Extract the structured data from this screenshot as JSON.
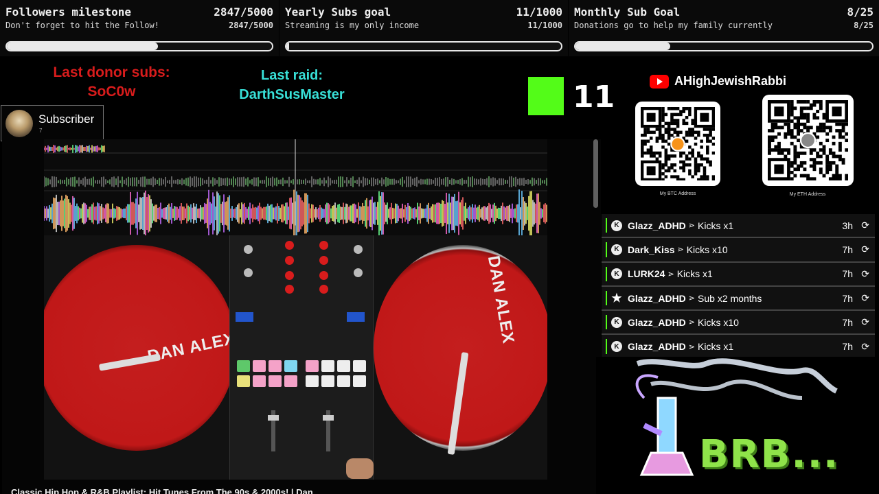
{
  "goals": [
    {
      "title": "Followers milestone",
      "count": "2847/5000",
      "subtitle": "Don't forget to hit the Follow!",
      "sub_count": "2847/5000",
      "progress": 0.5694
    },
    {
      "title": "Yearly Subs goal",
      "count": "11/1000",
      "subtitle": "Streaming is my only income",
      "sub_count": "11/1000",
      "progress": 0.011
    },
    {
      "title": "Monthly Sub Goal",
      "count": "8/25",
      "subtitle": "Donations go to help my family currently",
      "sub_count": "8/25",
      "progress": 0.32
    }
  ],
  "donor": {
    "label": "Last donor subs:",
    "name": "SoC0w"
  },
  "raid": {
    "label": "Last raid:",
    "name": "DarthSusMaster"
  },
  "kick": {
    "count": "11",
    "color": "#53fc18"
  },
  "subscriber_alert": {
    "label": "Subscriber",
    "count": "7"
  },
  "video": {
    "title": "Classic Hip Hop & R&B Playlist: Hit Tunes From The 90s & 2000s! | Dan",
    "left_platter_text": "DAN ALEX",
    "right_platter_text": "DAN ALEX"
  },
  "youtube": {
    "name": "AHighJewishRabbi",
    "icon": "youtube-icon"
  },
  "crypto": [
    {
      "caption": "My BTC Address",
      "icon": "bitcoin-icon",
      "color": "#f7931a"
    },
    {
      "caption": "My ETH Address",
      "icon": "ethereum-icon",
      "color": "#888888"
    }
  ],
  "events": [
    {
      "icon": "K",
      "user": "Glazz_ADHD",
      "msg": "Kicks x1",
      "time": "3h"
    },
    {
      "icon": "K",
      "user": "Dark_Kiss",
      "msg": "Kicks x10",
      "time": "7h"
    },
    {
      "icon": "K",
      "user": "LURK24",
      "msg": "Kicks x1",
      "time": "7h"
    },
    {
      "icon": "star",
      "user": "Glazz_ADHD",
      "msg": "Sub x2 months",
      "time": "7h"
    },
    {
      "icon": "K",
      "user": "Glazz_ADHD",
      "msg": "Kicks x10",
      "time": "7h"
    },
    {
      "icon": "K",
      "user": "Glazz_ADHD",
      "msg": "Kicks x1",
      "time": "7h"
    }
  ],
  "brb": {
    "text": "BRB..."
  }
}
